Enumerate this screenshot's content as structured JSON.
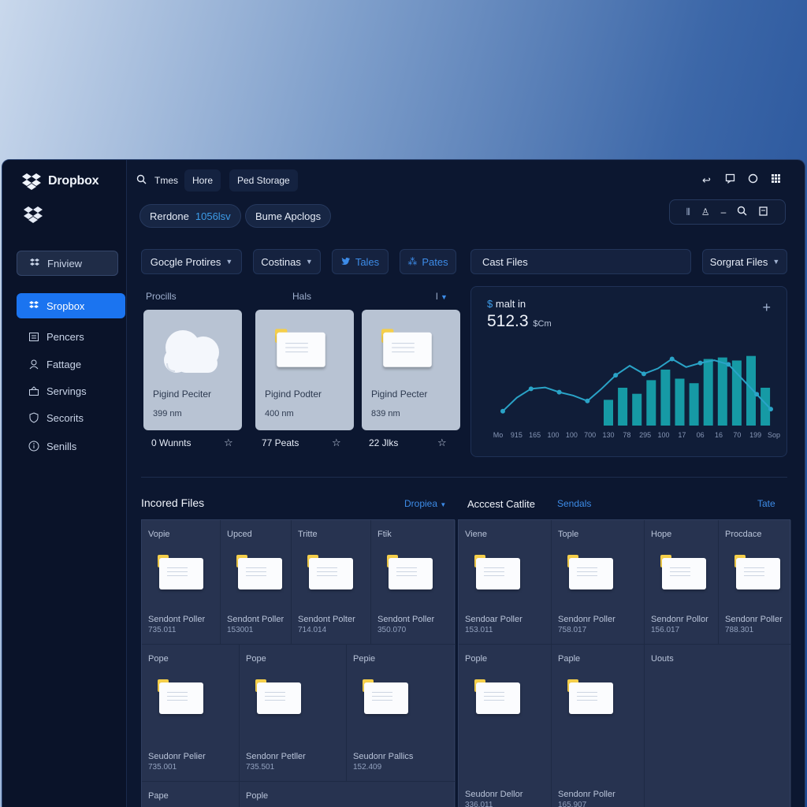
{
  "app": {
    "brand": "Dropbox"
  },
  "sidebar": {
    "items": [
      {
        "label": "Fniview",
        "icon": "review-icon"
      },
      {
        "label": "Sropbox",
        "icon": "dropbox-icon"
      },
      {
        "label": "Pencers",
        "icon": "folder-icon"
      },
      {
        "label": "Fattage",
        "icon": "user-icon"
      },
      {
        "label": "Servings",
        "icon": "share-icon"
      },
      {
        "label": "Secorits",
        "icon": "shield-icon"
      },
      {
        "label": "Senills",
        "icon": "info-icon"
      }
    ]
  },
  "header": {
    "search_tab_1": "Tmes",
    "search_tab_2": "Hore",
    "storage_pill": "Ped Storage",
    "pill_1_label": "Rerdone",
    "pill_1_value": "1056lsv",
    "pill_2_label": "Bume Apclogs"
  },
  "filters": {
    "google": "Gocgle Protires",
    "costinas": "Costinas",
    "tales": "Tales",
    "pates": "Pates",
    "cast_files": "Cast Files",
    "sorted_files": "Sorgrat Files"
  },
  "recent": {
    "label_left": "Procills",
    "label_mid": "Hals",
    "label_right": "l",
    "cards": [
      {
        "name": "Pigind Peciter",
        "size": "399 nm",
        "footer": "0 Wunnts"
      },
      {
        "name": "Pigind Podter",
        "size": "400 nm",
        "footer": "77 Peats"
      },
      {
        "name": "Pigind Pecter",
        "size": "839 nm",
        "footer": "22 Jlks"
      }
    ]
  },
  "chart_data": {
    "type": "bar",
    "title": "malt in",
    "value_label": "512.3",
    "value_unit": "$Cm",
    "categories": [
      "Mo",
      "915",
      "165",
      "100",
      "100",
      "700",
      "130",
      "78",
      "295",
      "100",
      "17",
      "06",
      "16",
      "70",
      "199",
      "Sop"
    ],
    "series": [
      {
        "type": "line",
        "values": [
          5,
          25,
          38,
          40,
          33,
          28,
          20,
          38,
          58,
          72,
          60,
          68,
          82,
          70,
          76,
          80,
          74,
          52,
          30,
          8
        ]
      },
      {
        "type": "bar",
        "values": [
          34,
          50,
          42,
          60,
          74,
          62,
          56,
          88,
          90,
          86,
          92,
          50
        ]
      }
    ],
    "colors": {
      "line": "#2aa3c7",
      "bar": "#169aa5"
    }
  },
  "files": {
    "title": "Incored Files",
    "dropdown": "Dropiea",
    "access_title": "Acccest Catlite",
    "tab_sendals": "Sendals",
    "tab_tate": "Tate",
    "left_row1": [
      {
        "head": "Vopie",
        "name": "Sendont Poller",
        "size": "735.011"
      },
      {
        "head": "Upced",
        "name": "Sendont Poller",
        "size": "153001"
      },
      {
        "head": "Tritte",
        "name": "Sendont Polter",
        "size": "714.014"
      },
      {
        "head": "Ftik",
        "name": "Sendont Poller",
        "size": "350.070"
      }
    ],
    "left_row2": [
      {
        "head": "Pope",
        "name": "Seudonr Pelier",
        "size": "735.001"
      },
      {
        "head": "Pope",
        "name": "Sendonr Petller",
        "size": "735.501"
      },
      {
        "head": "Pepie",
        "name": "Seudonr Pallics",
        "size": "152.409"
      }
    ],
    "left_row3": [
      {
        "head": "Pape"
      },
      {
        "head": "Pople"
      }
    ],
    "right_row1": [
      {
        "head": "Viene",
        "name": "Sendoar Poller",
        "size": "153.011"
      },
      {
        "head": "Tople",
        "name": "Sendonr Poller",
        "size": "758.017"
      },
      {
        "head": "Hope",
        "name": "Sendonr Pollor",
        "size": "156.017"
      },
      {
        "head": "Procdace",
        "name": "Sendonr Poller",
        "size": "788.301"
      }
    ],
    "right_row2": [
      {
        "head": "Pople",
        "name": "Seudonr Dellor",
        "size": "336.011"
      },
      {
        "head": "Paple",
        "name": "Sendonr Poller",
        "size": "165.907"
      },
      {
        "head": "Uouts"
      }
    ]
  }
}
